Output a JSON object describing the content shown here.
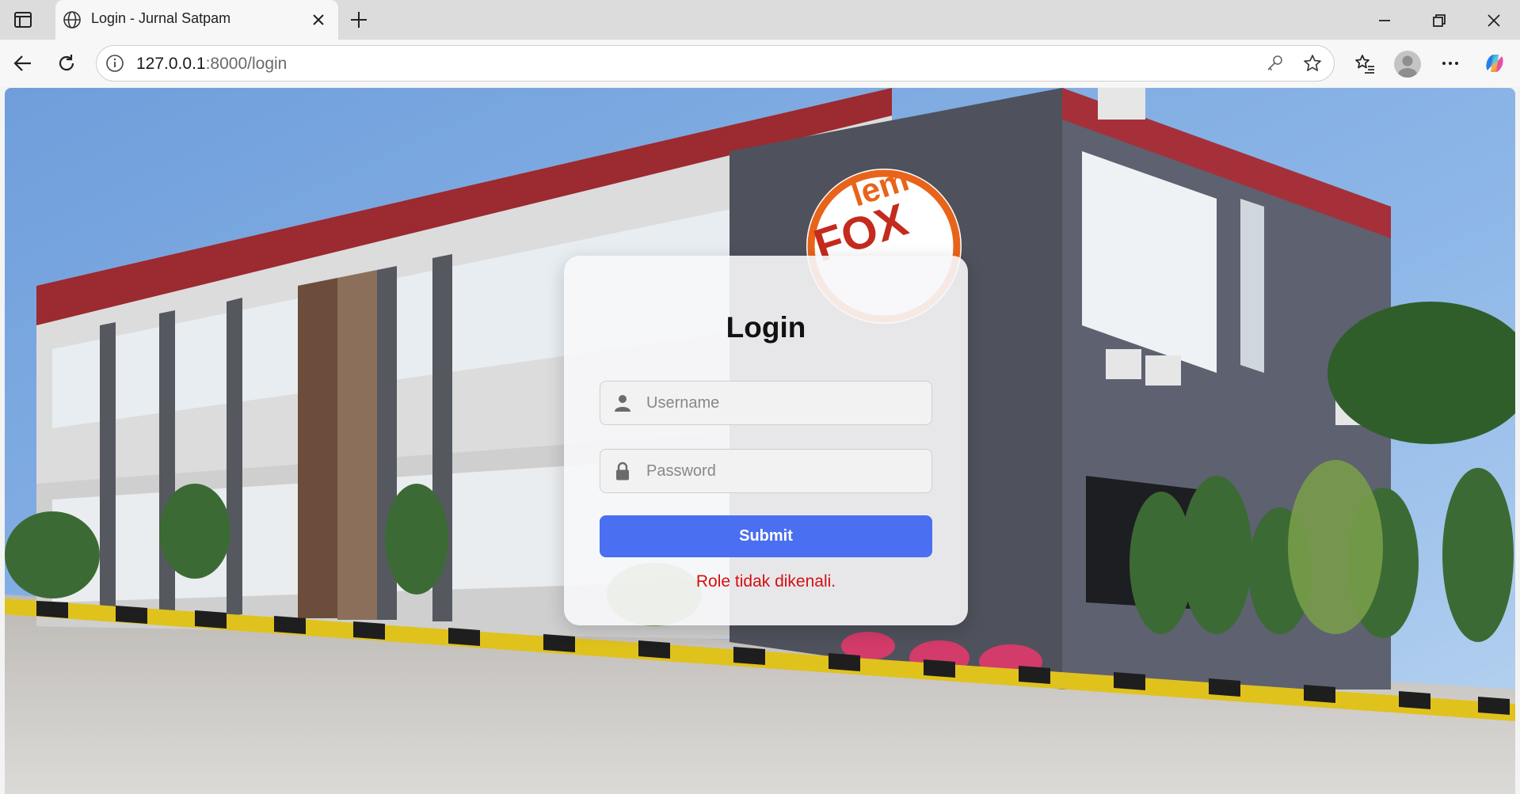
{
  "browser": {
    "tab_title": "Login - Jurnal Satpam",
    "url_host": "127.0.0.1",
    "url_path": ":8000/login"
  },
  "login": {
    "heading": "Login",
    "username_placeholder": "Username",
    "password_placeholder": "Password",
    "submit_label": "Submit",
    "error_message": "Role tidak dikenali."
  },
  "background": {
    "sign_text_top": "lem",
    "sign_text_bottom": "FOX"
  },
  "colors": {
    "submit_bg": "#4a6ff0",
    "error": "#d40f0f",
    "sign_orange": "#e8641a"
  }
}
